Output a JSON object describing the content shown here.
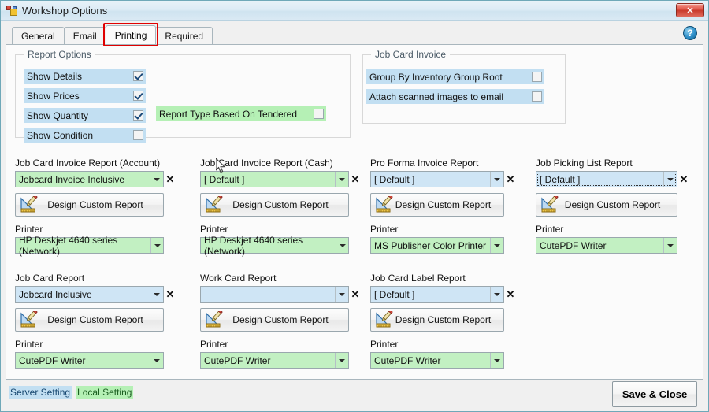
{
  "window": {
    "title": "Workshop Options",
    "close_label": "✕",
    "help_label": "?"
  },
  "tabs": [
    {
      "label": "General",
      "active": false
    },
    {
      "label": "Email",
      "active": false
    },
    {
      "label": "Printing",
      "active": true
    },
    {
      "label": "Required",
      "active": false
    }
  ],
  "report_options": {
    "title": "Report Options",
    "items": [
      {
        "label": "Show Details",
        "checked": true,
        "highlight": "blue"
      },
      {
        "label": "Show Prices",
        "checked": true,
        "highlight": "blue"
      },
      {
        "label": "Show Quantity",
        "checked": true,
        "highlight": "blue"
      },
      {
        "label": "Show Condition",
        "checked": false,
        "highlight": "blue"
      }
    ],
    "tendered": {
      "label": "Report Type Based On Tendered",
      "checked": false,
      "highlight": "green"
    }
  },
  "job_card_invoice": {
    "title": "Job Card Invoice",
    "items": [
      {
        "label": "Group By Inventory Group Root",
        "checked": false,
        "highlight": "blue"
      },
      {
        "label": "Attach scanned images to email",
        "checked": false,
        "highlight": "blue"
      }
    ]
  },
  "common": {
    "design_button_label": "Design Custom Report",
    "printer_label": "Printer",
    "clear_label": "✕"
  },
  "report_blocks": [
    {
      "label": "Job Card Invoice Report (Account)",
      "report_value": "Jobcard Invoice Inclusive",
      "report_highlight": "green",
      "focused": false,
      "printer_value": "HP Deskjet 4640 series (Network)",
      "printer_highlight": "green"
    },
    {
      "label": "Job Card Invoice Report (Cash)",
      "report_value": "[ Default ]",
      "report_highlight": "green",
      "focused": false,
      "printer_value": "HP Deskjet 4640 series (Network)",
      "printer_highlight": "green"
    },
    {
      "label": "Pro Forma Invoice Report",
      "report_value": "[ Default ]",
      "report_highlight": "blue",
      "focused": false,
      "printer_value": "MS Publisher Color Printer",
      "printer_highlight": "green"
    },
    {
      "label": "Job Picking List Report",
      "report_value": "[ Default ]",
      "report_highlight": "blue",
      "focused": true,
      "printer_value": "CutePDF Writer",
      "printer_highlight": "green"
    },
    {
      "label": "Job Card Report",
      "report_value": "Jobcard Inclusive",
      "report_highlight": "blue",
      "focused": false,
      "printer_value": "CutePDF Writer",
      "printer_highlight": "green"
    },
    {
      "label": "Work Card Report",
      "report_value": "",
      "report_highlight": "blue",
      "focused": false,
      "printer_value": "CutePDF Writer",
      "printer_highlight": "green"
    },
    {
      "label": "Job Card Label Report",
      "report_value": "[ Default ]",
      "report_highlight": "blue",
      "focused": false,
      "printer_value": "CutePDF Writer",
      "printer_highlight": "green"
    }
  ],
  "footer": {
    "legend_server": "Server Setting",
    "legend_local": "Local Setting",
    "save_close_label": "Save & Close"
  },
  "colors": {
    "server_setting": "#c2dff2",
    "local_setting": "#b5f0b5",
    "highlight_box": "#e00000",
    "close_button": "#c93a2c"
  }
}
